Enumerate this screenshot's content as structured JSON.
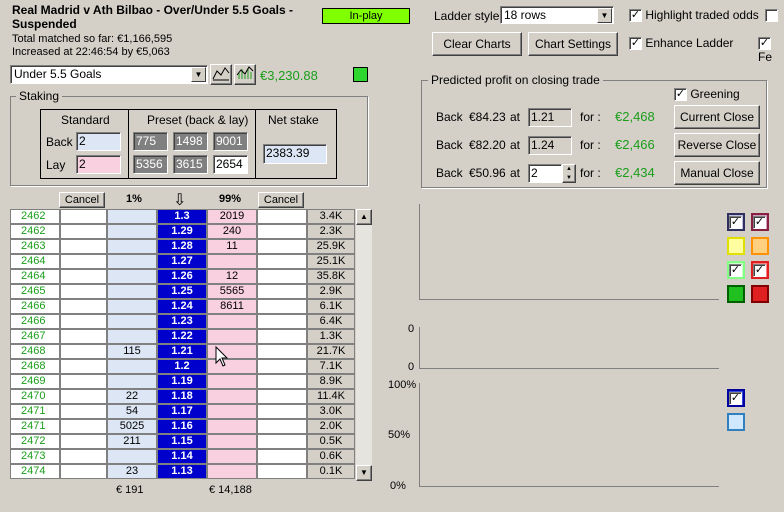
{
  "header": {
    "title": "Real Madrid v Ath Bilbao - Over/Under 5.5 Goals - Suspended",
    "total_matched": "Total matched so far: €1,166,595",
    "increased": "Increased at 22:46:54 by €5,063",
    "inplay": "In-play"
  },
  "market": {
    "selected": "Under 5.5 Goals",
    "amount": "€3,230.88"
  },
  "controls": {
    "ladder_style_label": "Ladder style",
    "ladder_style_value": "18 rows",
    "highlight": "Highlight traded odds",
    "enhance": "Enhance Ladder",
    "clear_charts": "Clear Charts",
    "chart_settings": "Chart Settings",
    "fe": "Fe"
  },
  "staking": {
    "title": "Staking",
    "standard": "Standard",
    "preset": "Preset (back & lay)",
    "net_stake": "Net stake",
    "back_label": "Back",
    "lay_label": "Lay",
    "back_value": "2",
    "lay_value": "2",
    "back_presets": [
      "775",
      "1498",
      "9001"
    ],
    "lay_presets": [
      "5356",
      "3615",
      "2654"
    ],
    "net_value": "2383.39"
  },
  "profit": {
    "title": "Predicted profit on closing trade",
    "greening": "Greening",
    "rows": [
      {
        "back": "Back",
        "amount": "€84.23",
        "at": "at",
        "odds": "1.21",
        "for": "for :",
        "profit": "€2,468",
        "button": "Current Close"
      },
      {
        "back": "Back",
        "amount": "€82.20",
        "at": "at",
        "odds": "1.24",
        "for": "for :",
        "profit": "€2,466",
        "button": "Reverse Close"
      },
      {
        "back": "Back",
        "amount": "€50.96",
        "at": "at",
        "odds": "2",
        "for": "for :",
        "profit": "€2,434",
        "button": "Manual Close"
      }
    ]
  },
  "ladder": {
    "cancel": "Cancel",
    "back_pct": "1%",
    "lay_pct": "99%",
    "arrow": "⇩",
    "back_total": "€ 191",
    "lay_total": "€ 14,188",
    "rows": [
      {
        "id": "2462",
        "back": "",
        "odds": "1.3",
        "lay": "2019",
        "vol": "3.4K"
      },
      {
        "id": "2462",
        "back": "",
        "odds": "1.29",
        "lay": "240",
        "vol": "2.3K"
      },
      {
        "id": "2463",
        "back": "",
        "odds": "1.28",
        "lay": "11",
        "vol": "25.9K"
      },
      {
        "id": "2464",
        "back": "",
        "odds": "1.27",
        "lay": "",
        "vol": "25.1K"
      },
      {
        "id": "2464",
        "back": "",
        "odds": "1.26",
        "lay": "12",
        "vol": "35.8K"
      },
      {
        "id": "2465",
        "back": "",
        "odds": "1.25",
        "lay": "5565",
        "vol": "2.9K"
      },
      {
        "id": "2466",
        "back": "",
        "odds": "1.24",
        "lay": "8611",
        "vol": "6.1K"
      },
      {
        "id": "2466",
        "back": "",
        "odds": "1.23",
        "lay": "",
        "vol": "6.4K"
      },
      {
        "id": "2467",
        "back": "",
        "odds": "1.22",
        "lay": "",
        "vol": "1.3K"
      },
      {
        "id": "2468",
        "back": "115",
        "odds": "1.21",
        "lay": "",
        "vol": "21.7K"
      },
      {
        "id": "2468",
        "back": "",
        "odds": "1.2",
        "lay": "",
        "vol": "7.1K"
      },
      {
        "id": "2469",
        "back": "",
        "odds": "1.19",
        "lay": "",
        "vol": "8.9K"
      },
      {
        "id": "2470",
        "back": "22",
        "odds": "1.18",
        "lay": "",
        "vol": "11.4K"
      },
      {
        "id": "2471",
        "back": "54",
        "odds": "1.17",
        "lay": "",
        "vol": "3.0K"
      },
      {
        "id": "2471",
        "back": "5025",
        "odds": "1.16",
        "lay": "",
        "vol": "2.0K"
      },
      {
        "id": "2472",
        "back": "211",
        "odds": "1.15",
        "lay": "",
        "vol": "0.5K"
      },
      {
        "id": "2473",
        "back": "",
        "odds": "1.14",
        "lay": "",
        "vol": "0.6K"
      },
      {
        "id": "2474",
        "back": "23",
        "odds": "1.13",
        "lay": "",
        "vol": "0.1K"
      }
    ]
  },
  "charts": {
    "zero_a": "0",
    "zero_b": "0",
    "pct100": "100%",
    "pct50": "50%",
    "pct0": "0%"
  },
  "colors": {
    "odds_bg": "#0000cc",
    "back_bg": "#dce6f4",
    "lay_bg": "#f8d0e0",
    "accent_green": "#1a9e1a",
    "inplay_bg": "#7fff00"
  }
}
